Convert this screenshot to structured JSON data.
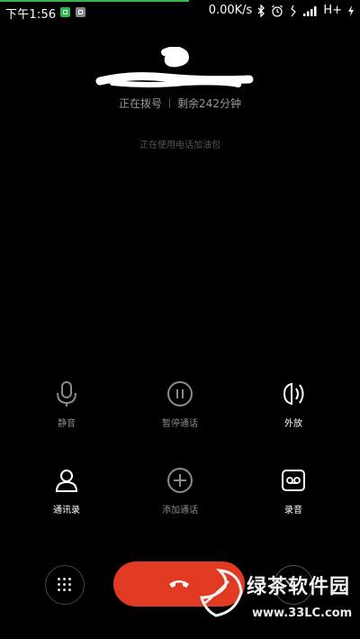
{
  "status_bar": {
    "time": "下午1:56",
    "net_speed": "0.00K/s",
    "network_type": "H+",
    "icons": [
      "notification-green-icon",
      "notification-grey-icon",
      "bluetooth-icon",
      "alarm-icon",
      "vibrate-icon",
      "signal-icon",
      "charging-icon"
    ]
  },
  "call": {
    "status": "正在拨号",
    "remaining": "剩余242分钟",
    "note": "正在使用电话加油包"
  },
  "controls": [
    {
      "label": "静音",
      "icon": "microphone-icon"
    },
    {
      "label": "暂停通话",
      "icon": "pause-icon"
    },
    {
      "label": "外放",
      "icon": "speaker-icon"
    },
    {
      "label": "通讯录",
      "icon": "contacts-icon"
    },
    {
      "label": "添加通话",
      "icon": "add-call-icon"
    },
    {
      "label": "录音",
      "icon": "record-icon"
    }
  ],
  "bottom": {
    "dialpad_icon": "dialpad-icon",
    "end_call_icon": "end-call-icon",
    "collapse_icon": "chevron-down-icon"
  },
  "watermark": {
    "title": "绿茶软件园",
    "url": "www.33LC.com"
  },
  "colors": {
    "background": "#000000",
    "end_call": "#e13a22",
    "status_text": "#9a9a9a",
    "top_progress": "#39b54a"
  }
}
